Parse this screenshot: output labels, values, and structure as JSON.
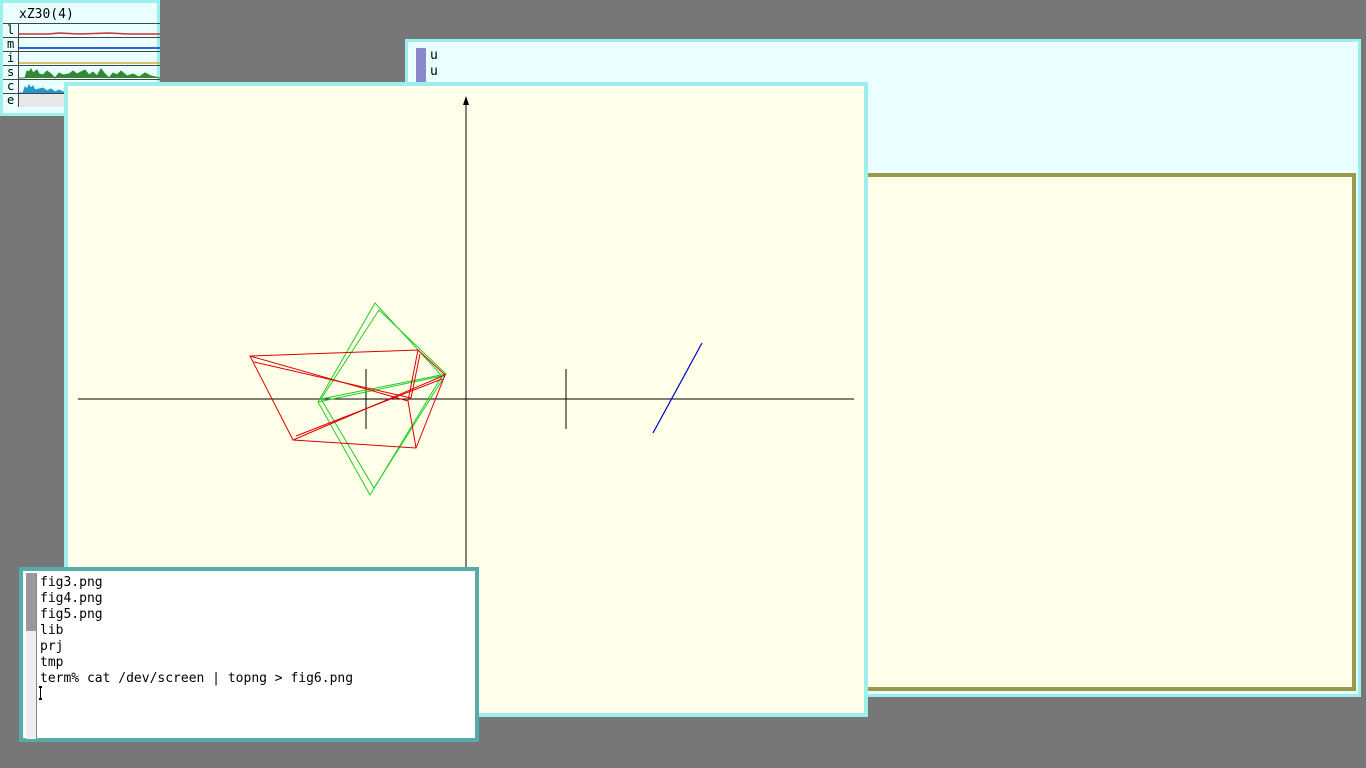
{
  "stats": {
    "title": "xZ30(4)",
    "rows": [
      {
        "label": "l",
        "color": "#cc3333"
      },
      {
        "label": "m",
        "color": "#3366cc"
      },
      {
        "label": "i",
        "color": "#ccaa44"
      },
      {
        "label": "s",
        "color": "#338833"
      },
      {
        "label": "c",
        "color": "#2299cc"
      },
      {
        "label": "e",
        "color": "#888888"
      }
    ]
  },
  "acme": {
    "tag_lines": [
      "u",
      "u"
    ]
  },
  "terminal": {
    "lines": [
      "fig3.png",
      "fig4.png",
      "fig5.png",
      "lib",
      "prj",
      "tmp",
      "term% cat /dev/screen | topng > fig6.png"
    ]
  },
  "colors": {
    "desktop": "#777777",
    "window_border": "#9eeeee",
    "plot_bg": "#ffffea",
    "red_shape": "#dd0000",
    "green_shape": "#22cc22",
    "blue_line": "#0000cc"
  },
  "icons": {
    "pointer": "arrow-pointer-icon",
    "axis_arrow": "up-arrow-icon"
  }
}
